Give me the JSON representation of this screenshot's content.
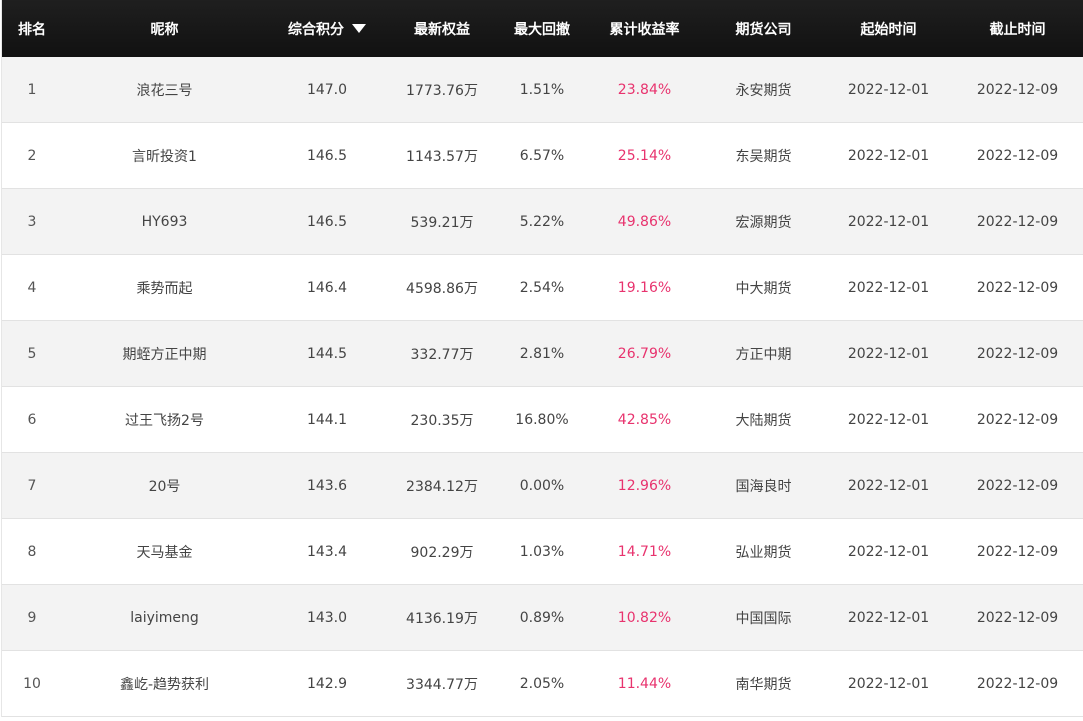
{
  "headers": {
    "rank": "排名",
    "name": "昵称",
    "score": "综合积分",
    "equity": "最新权益",
    "drawdown": "最大回撤",
    "return": "累计收益率",
    "broker": "期货公司",
    "start": "起始时间",
    "end": "截止时间"
  },
  "sort": {
    "column": "score",
    "direction": "descending",
    "icon": "sort-down-icon"
  },
  "colors": {
    "header_bg": "#161616",
    "return_text": "#e8336e",
    "odd_row": "#f3f3f3"
  },
  "rows": [
    {
      "rank": "1",
      "name": "浪花三号",
      "score": "147.0",
      "equity": "1773.76万",
      "drawdown": "1.51%",
      "return": "23.84%",
      "broker": "永安期货",
      "start": "2022-12-01",
      "end": "2022-12-09"
    },
    {
      "rank": "2",
      "name": "言昕投资1",
      "score": "146.5",
      "equity": "1143.57万",
      "drawdown": "6.57%",
      "return": "25.14%",
      "broker": "东吴期货",
      "start": "2022-12-01",
      "end": "2022-12-09"
    },
    {
      "rank": "3",
      "name": "HY693",
      "score": "146.5",
      "equity": "539.21万",
      "drawdown": "5.22%",
      "return": "49.86%",
      "broker": "宏源期货",
      "start": "2022-12-01",
      "end": "2022-12-09"
    },
    {
      "rank": "4",
      "name": "乘势而起",
      "score": "146.4",
      "equity": "4598.86万",
      "drawdown": "2.54%",
      "return": "19.16%",
      "broker": "中大期货",
      "start": "2022-12-01",
      "end": "2022-12-09"
    },
    {
      "rank": "5",
      "name": "期蛭方正中期",
      "score": "144.5",
      "equity": "332.77万",
      "drawdown": "2.81%",
      "return": "26.79%",
      "broker": "方正中期",
      "start": "2022-12-01",
      "end": "2022-12-09"
    },
    {
      "rank": "6",
      "name": "过王飞扬2号",
      "score": "144.1",
      "equity": "230.35万",
      "drawdown": "16.80%",
      "return": "42.85%",
      "broker": "大陆期货",
      "start": "2022-12-01",
      "end": "2022-12-09"
    },
    {
      "rank": "7",
      "name": "20号",
      "score": "143.6",
      "equity": "2384.12万",
      "drawdown": "0.00%",
      "return": "12.96%",
      "broker": "国海良时",
      "start": "2022-12-01",
      "end": "2022-12-09"
    },
    {
      "rank": "8",
      "name": "天马基金",
      "score": "143.4",
      "equity": "902.29万",
      "drawdown": "1.03%",
      "return": "14.71%",
      "broker": "弘业期货",
      "start": "2022-12-01",
      "end": "2022-12-09"
    },
    {
      "rank": "9",
      "name": "laiyimeng",
      "score": "143.0",
      "equity": "4136.19万",
      "drawdown": "0.89%",
      "return": "10.82%",
      "broker": "中国国际",
      "start": "2022-12-01",
      "end": "2022-12-09"
    },
    {
      "rank": "10",
      "name": "鑫屹-趋势获利",
      "score": "142.9",
      "equity": "3344.77万",
      "drawdown": "2.05%",
      "return": "11.44%",
      "broker": "南华期货",
      "start": "2022-12-01",
      "end": "2022-12-09"
    }
  ]
}
